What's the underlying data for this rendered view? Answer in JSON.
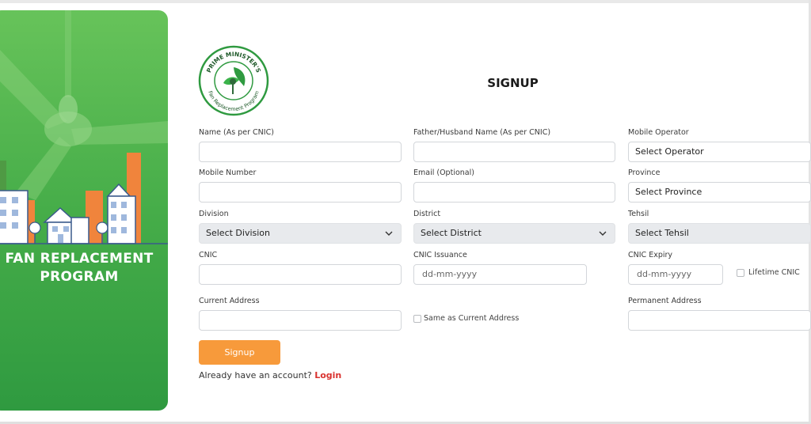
{
  "left_panel": {
    "program_title_line1": "FAN REPLACEMENT",
    "program_title_line2": "PROGRAM"
  },
  "logo": {
    "top_text": "PRIME MINISTER'S",
    "bottom_text": "Fan Replacement Program"
  },
  "page": {
    "title": "SIGNUP"
  },
  "form": {
    "name_label": "Name (As per CNIC)",
    "name_value": "",
    "father_label": "Father/Husband Name (As per CNIC)",
    "father_value": "",
    "operator_label": "Mobile Operator",
    "operator_value": "Select Operator",
    "mobile_label": "Mobile Number",
    "mobile_value": "",
    "email_label": "Email (Optional)",
    "email_value": "",
    "province_label": "Province",
    "province_value": "Select Province",
    "division_label": "Division",
    "division_value": "Select Division",
    "district_label": "District",
    "district_value": "Select District",
    "tehsil_label": "Tehsil",
    "tehsil_value": "Select Tehsil",
    "cnic_label": "CNIC",
    "cnic_value": "",
    "cnic_issuance_label": "CNIC Issuance",
    "cnic_issuance_placeholder": "dd-mm-yyyy",
    "cnic_expiry_label": "CNIC Expiry",
    "cnic_expiry_placeholder": "dd-mm-yyyy",
    "lifetime_label": "Lifetime CNIC",
    "current_address_label": "Current Address",
    "current_address_value": "",
    "same_as_label": "Same as Current Address",
    "permanent_address_label": "Permanent Address",
    "permanent_address_value": ""
  },
  "actions": {
    "signup_label": "Signup",
    "account_text": "Already have an account?",
    "login_label": "Login"
  },
  "colors": {
    "panel_green": "#46ad49",
    "button_orange": "#f79a3b",
    "login_red": "#d9322f"
  }
}
